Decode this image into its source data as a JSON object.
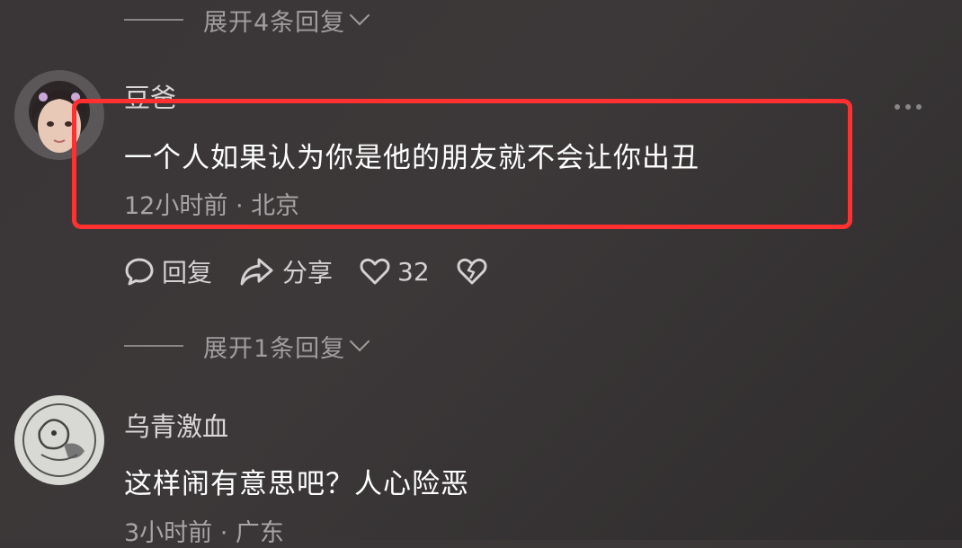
{
  "thread_top": {
    "expand_label": "展开4条回复"
  },
  "comment1": {
    "author": "豆爸",
    "text": "一个人如果认为你是他的朋友就不会让你出丑",
    "meta": "12小时前 · 北京",
    "actions": {
      "reply": "回复",
      "share": "分享",
      "like_count": "32"
    },
    "expand_label": "展开1条回复"
  },
  "comment2": {
    "author": "乌青激血",
    "text": "这样闹有意思吧？人心险恶",
    "meta": "3小时前 · 广东"
  },
  "colors": {
    "highlight": "#ff3030",
    "background": "#3a3637"
  }
}
